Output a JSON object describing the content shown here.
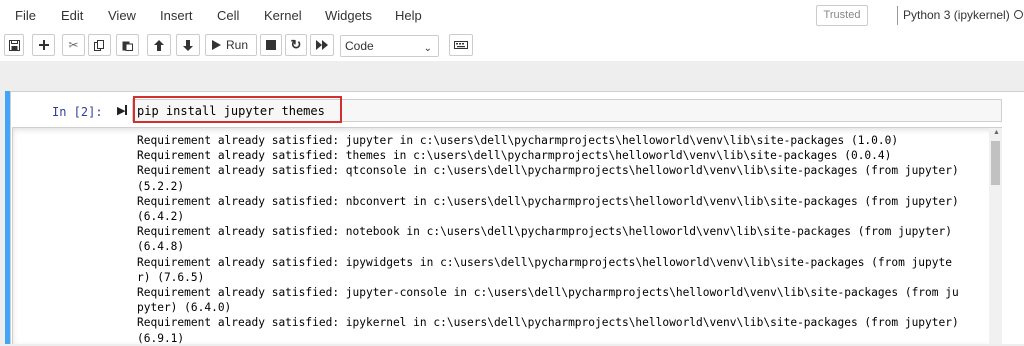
{
  "menu": {
    "items": [
      "File",
      "Edit",
      "View",
      "Insert",
      "Cell",
      "Kernel",
      "Widgets",
      "Help"
    ]
  },
  "status": {
    "trusted": "Trusted",
    "kernel": "Python 3 (ipykernel)"
  },
  "toolbar": {
    "run_label": "Run",
    "cell_type": "Code",
    "icons": [
      "save-icon",
      "add-cell-icon",
      "cut-icon",
      "copy-icon",
      "paste-icon",
      "move-up-icon",
      "move-down-icon",
      "run-icon",
      "stop-icon",
      "restart-icon",
      "fast-forward-icon",
      "keyboard-icon"
    ]
  },
  "cell": {
    "prompt": "In [2]:",
    "code": "pip install jupyter themes",
    "output_lines": [
      "Requirement already satisfied: jupyter in c:\\users\\dell\\pycharmprojects\\helloworld\\venv\\lib\\site-packages (1.0.0)",
      "Requirement already satisfied: themes in c:\\users\\dell\\pycharmprojects\\helloworld\\venv\\lib\\site-packages (0.0.4)",
      "Requirement already satisfied: qtconsole in c:\\users\\dell\\pycharmprojects\\helloworld\\venv\\lib\\site-packages (from jupyter)",
      "(5.2.2)",
      "Requirement already satisfied: nbconvert in c:\\users\\dell\\pycharmprojects\\helloworld\\venv\\lib\\site-packages (from jupyter)",
      "(6.4.2)",
      "Requirement already satisfied: notebook in c:\\users\\dell\\pycharmprojects\\helloworld\\venv\\lib\\site-packages (from jupyter)",
      "(6.4.8)",
      "Requirement already satisfied: ipywidgets in c:\\users\\dell\\pycharmprojects\\helloworld\\venv\\lib\\site-packages (from jupyte",
      "r) (7.6.5)",
      "Requirement already satisfied: jupyter-console in c:\\users\\dell\\pycharmprojects\\helloworld\\venv\\lib\\site-packages (from ju",
      "pyter) (6.4.0)",
      "Requirement already satisfied: ipykernel in c:\\users\\dell\\pycharmprojects\\helloworld\\venv\\lib\\site-packages (from jupyter)",
      "(6.9.1)"
    ]
  },
  "colors": {
    "accent": "#42a5f5",
    "highlight": "#d32f2f",
    "prompt": "#303f9f"
  }
}
